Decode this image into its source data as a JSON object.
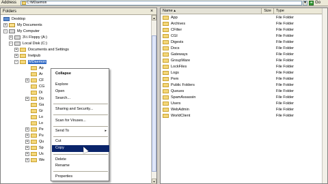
{
  "address": {
    "label": "Address",
    "path": "C:\\MDaemon",
    "go_label": "Go"
  },
  "folders_panel": {
    "title": "Folders",
    "close_label": "×"
  },
  "tree": [
    {
      "label": "Desktop",
      "icon": "desktop-icon"
    },
    {
      "label": "My Documents",
      "icon": "documents-icon"
    },
    {
      "label": "My Computer",
      "icon": "computer-icon"
    },
    {
      "label": "3½ Floppy (A:)",
      "icon": "floppy-icon"
    },
    {
      "label": "Local Disk (C:)",
      "icon": "drive-icon"
    },
    {
      "label": "Documents and Settings",
      "icon": "folder-icon"
    },
    {
      "label": "Inetpub",
      "icon": "folder-icon"
    },
    {
      "label": "MDaemon",
      "icon": "folder-icon",
      "selected": true
    },
    {
      "label": "Ap",
      "icon": "folder-icon"
    },
    {
      "label": "Ar",
      "icon": "folder-icon"
    },
    {
      "label": "CF",
      "icon": "folder-icon"
    },
    {
      "label": "CG",
      "icon": "folder-icon"
    },
    {
      "label": "Di",
      "icon": "folder-icon"
    },
    {
      "label": "Do",
      "icon": "folder-icon"
    },
    {
      "label": "Ga",
      "icon": "folder-icon"
    },
    {
      "label": "Gr",
      "icon": "folder-icon"
    },
    {
      "label": "Lo",
      "icon": "folder-icon"
    },
    {
      "label": "Lo",
      "icon": "folder-icon"
    },
    {
      "label": "Pe",
      "icon": "folder-icon"
    },
    {
      "label": "Pu",
      "icon": "folder-icon"
    },
    {
      "label": "Qu",
      "icon": "folder-icon"
    },
    {
      "label": "Sp",
      "icon": "folder-icon"
    },
    {
      "label": "Us",
      "icon": "folder-icon"
    },
    {
      "label": "We",
      "icon": "folder-icon"
    }
  ],
  "context_menu": {
    "items": [
      {
        "label": "Collapse",
        "bold": true
      },
      {
        "label": "Explore"
      },
      {
        "label": "Open"
      },
      {
        "label": "Search..."
      },
      {
        "label": "Sharing and Security..."
      },
      {
        "label": "Scan for Viruses..."
      },
      {
        "label": "Send To",
        "submenu": "▸"
      },
      {
        "label": "Cut"
      },
      {
        "label": "Copy",
        "highlighted": true
      },
      {
        "label": "Delete"
      },
      {
        "label": "Rename"
      },
      {
        "label": "Properties"
      }
    ]
  },
  "file_list": {
    "columns": {
      "name": "Name",
      "size": "Size",
      "type": "Type"
    },
    "rows": [
      {
        "name": "App",
        "type": "File Folder"
      },
      {
        "name": "Archives",
        "type": "File Folder"
      },
      {
        "name": "CFilter",
        "type": "File Folder"
      },
      {
        "name": "CGI",
        "type": "File Folder"
      },
      {
        "name": "Digests",
        "type": "File Folder"
      },
      {
        "name": "Docs",
        "type": "File Folder"
      },
      {
        "name": "Gateways",
        "type": "File Folder"
      },
      {
        "name": "GroupWare",
        "type": "File Folder"
      },
      {
        "name": "LockFiles",
        "type": "File Folder"
      },
      {
        "name": "Logs",
        "type": "File Folder"
      },
      {
        "name": "Pem",
        "type": "File Folder"
      },
      {
        "name": "Public Folders",
        "type": "File Folder"
      },
      {
        "name": "Queues",
        "type": "File Folder"
      },
      {
        "name": "SpamAssassin",
        "type": "File Folder"
      },
      {
        "name": "Users",
        "type": "File Folder"
      },
      {
        "name": "WebAdmin",
        "type": "File Folder"
      },
      {
        "name": "WorldClient",
        "type": "File Folder"
      }
    ]
  },
  "colors": {
    "selection": "#316ac5",
    "menu_highlight": "#0a246a",
    "folder": "#f4d77a"
  }
}
